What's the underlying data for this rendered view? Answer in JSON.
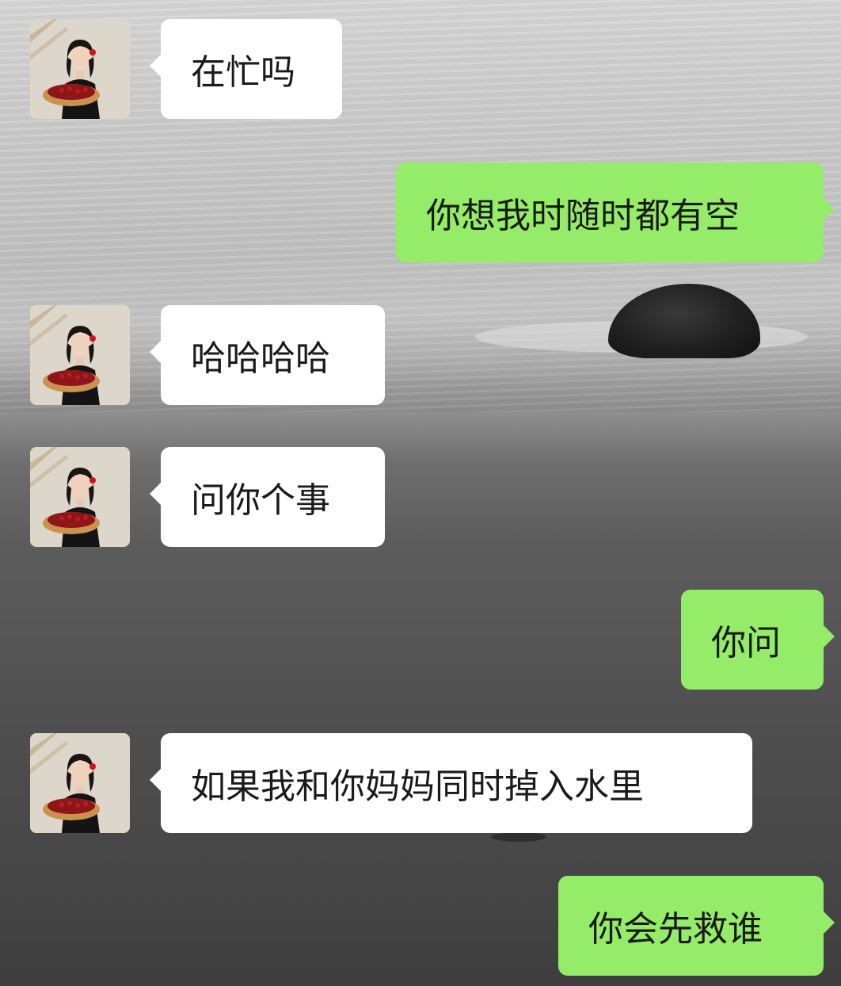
{
  "chat": {
    "messages": [
      {
        "side": "incoming",
        "text": "在忙吗",
        "avatar": "contact-avatar"
      },
      {
        "side": "outgoing",
        "text": "你想我时随时都有空"
      },
      {
        "side": "incoming",
        "text": "哈哈哈哈",
        "avatar": "contact-avatar"
      },
      {
        "side": "incoming",
        "text": "问你个事",
        "avatar": "contact-avatar"
      },
      {
        "side": "outgoing",
        "text": "你问"
      },
      {
        "side": "incoming",
        "text": "如果我和你妈妈同时掉入水里",
        "avatar": "contact-avatar"
      },
      {
        "side": "outgoing",
        "text": "你会先救谁"
      }
    ]
  },
  "colors": {
    "incoming_bubble": "#ffffff",
    "outgoing_bubble": "#95ec69",
    "text": "#1a1a1a"
  }
}
